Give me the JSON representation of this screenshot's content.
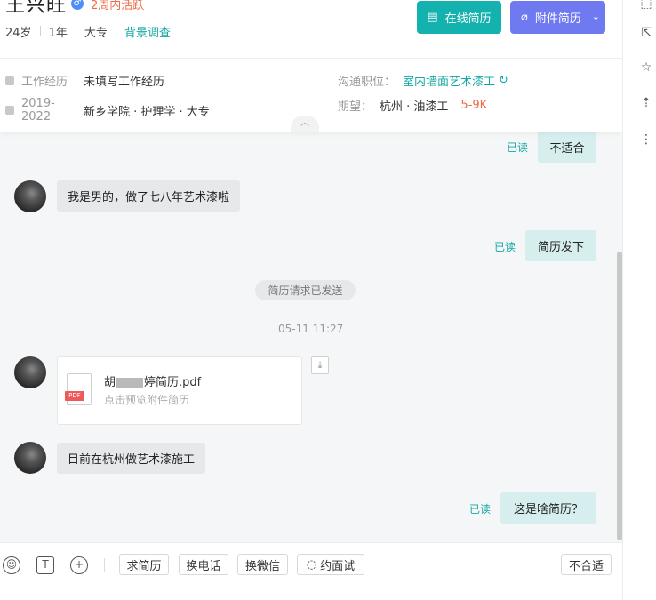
{
  "candidate": {
    "name": "王兴旺",
    "gender_icon": "male-icon",
    "active_status": "2周内活跃",
    "age": "24岁",
    "experience": "1年",
    "education": "大专",
    "background_check": "背景调查"
  },
  "buttons": {
    "online_resume": "在线简历",
    "attachment_resume": "附件简历"
  },
  "info": {
    "work_label": "工作经历",
    "work_value": "未填写工作经历",
    "edu_years": "2019-2022",
    "edu_value": "新乡学院 · 护理学 · 大专",
    "position_label": "沟通职位：",
    "position_value": "室内墙面艺术漆工",
    "expect_label": "期望：",
    "expect_value": "杭州 · 油漆工",
    "expect_salary": "5-9K"
  },
  "messages": {
    "read_label": "已读",
    "m1": "不适合",
    "m2": "我是男的，做了七八年艺术漆啦",
    "m3": "简历发下",
    "system_notice": "简历请求已发送",
    "timestamp": "05-11 11:27",
    "file_name_prefix": "胡",
    "file_name_suffix": "婷简历.pdf",
    "file_hint": "点击预览附件简历",
    "file_type": "PDF",
    "m4": "目前在杭州做艺术漆施工",
    "m5": "这是啥简历？"
  },
  "composer": {
    "request_resume": "求简历",
    "exchange_phone": "换电话",
    "exchange_wechat": "换微信",
    "interview": "约面试",
    "not_suitable": "不合适"
  },
  "colors": {
    "teal": "#14b2ae",
    "purple": "#6f79f0",
    "orange": "#f06a49"
  }
}
